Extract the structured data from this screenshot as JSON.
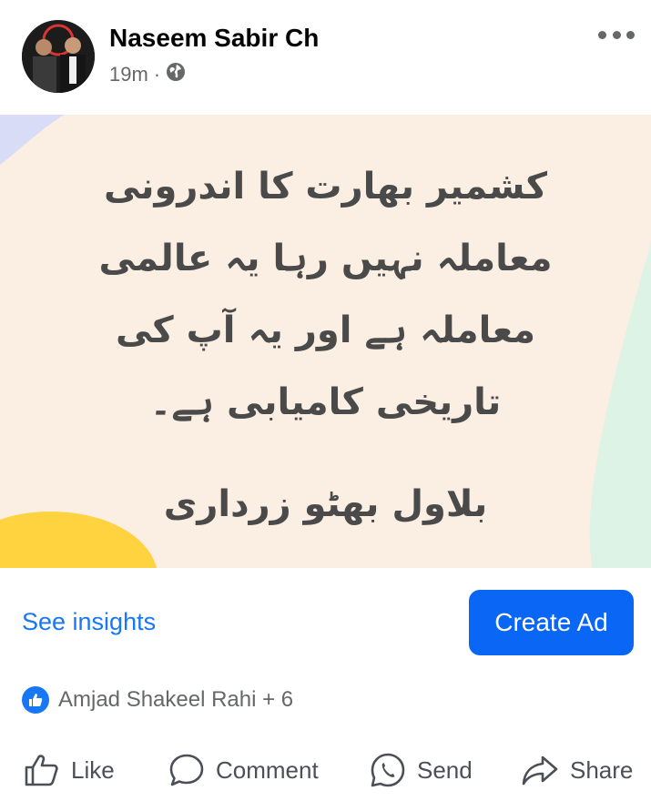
{
  "post": {
    "author": "Naseem Sabir Ch",
    "time": "19m",
    "separator": "·",
    "privacy_icon": "globe-icon",
    "more_icon": "more-dots-icon",
    "text_lines": [
      "کشمیر بھارت کا اندرونی",
      "معاملہ نہیں رہا یہ عالمی",
      "معاملہ ہے اور یہ آپ کی",
      "تاریخی کامیابی ہے۔"
    ],
    "signature": "بلاول بھٹو زرداری",
    "background_color": "#fbeee2"
  },
  "insights_label": "See insights",
  "create_ad_label": "Create Ad",
  "reactions": {
    "icon": "like-reaction-icon",
    "text": "Amjad Shakeel Rahi + 6"
  },
  "actions": [
    {
      "label": "Like",
      "icon": "like-icon"
    },
    {
      "label": "Comment",
      "icon": "comment-icon"
    },
    {
      "label": "Send",
      "icon": "send-icon"
    },
    {
      "label": "Share",
      "icon": "share-icon"
    }
  ],
  "colors": {
    "accent": "#1877f2",
    "button": "#0a66f5",
    "secondary_text": "#65676b"
  }
}
